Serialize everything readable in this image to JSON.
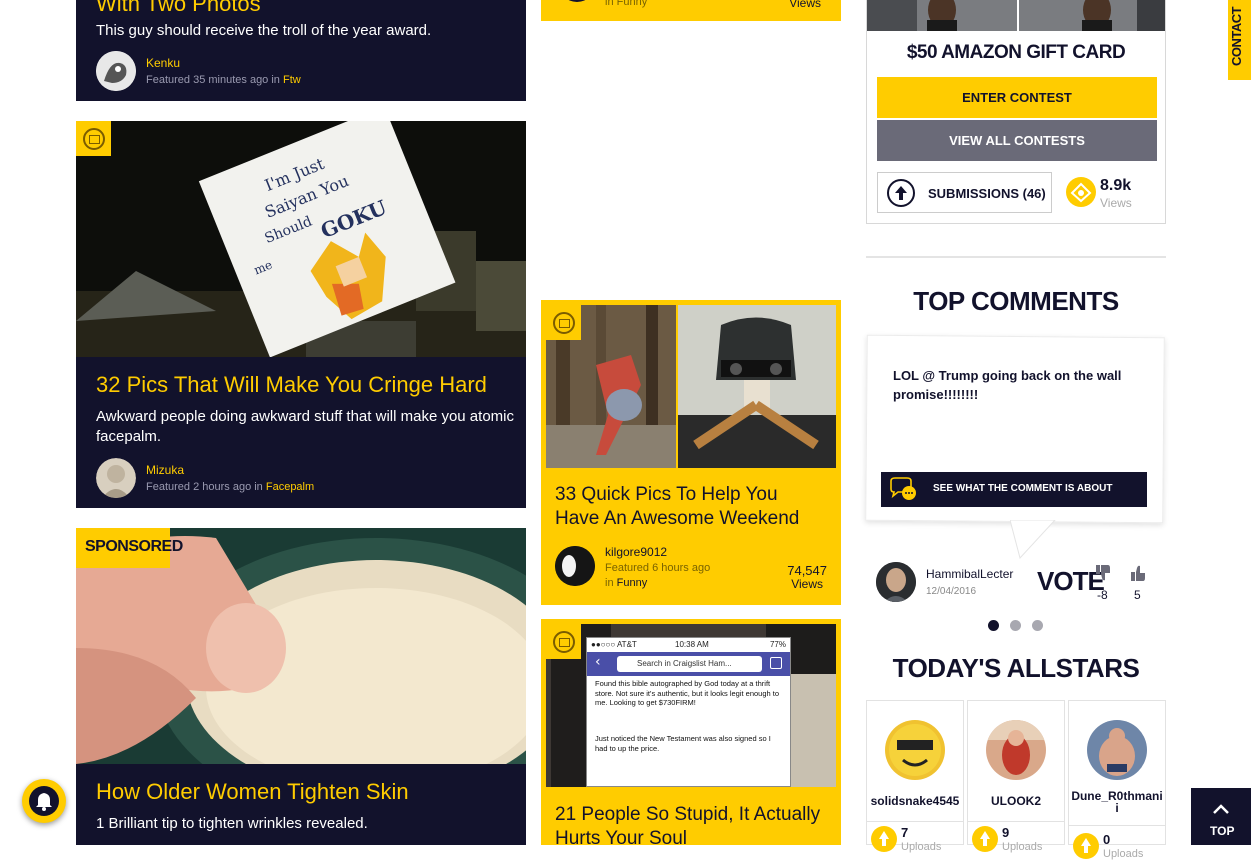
{
  "card1": {
    "title": "With Two Photos",
    "desc": "This guy should receive the troll of the year award.",
    "user": "Kenku",
    "meta_prefix": "Featured 35 minutes ago in ",
    "category": "Ftw"
  },
  "card2": {
    "image_sign_text": "I'm Just Saiyan You Should GOKU PROM with me",
    "title": "32 Pics That Will Make You Cringe Hard",
    "desc": "Awkward people doing awkward stuff that will make you atomic facepalm.",
    "user": "Mizuka",
    "meta_prefix": "Featured 2 hours ago in ",
    "category": "Facepalm"
  },
  "card3": {
    "sponsored_label": "SPONSORED",
    "title": "How Older Women Tighten Skin",
    "desc": "1 Brilliant tip to tighten wrinkles revealed."
  },
  "mid_top": {
    "meta": "in Funny",
    "views_label": "Views"
  },
  "mid_card1": {
    "title": "33 Quick Pics To Help You Have An Awesome Weekend",
    "user": "kilgore9012",
    "meta_prefix": "Featured 6 hours ago",
    "meta_in": "in ",
    "category": "Funny",
    "views": "74,547",
    "views_label": "Views"
  },
  "mid_card2": {
    "title": "21 People So Stupid, It Actually Hurts Your Soul",
    "phone_carrier": "●●○○○ AT&T",
    "phone_time": "10:38 AM",
    "phone_battery": "77%",
    "phone_search": "Search in Craigslist Ham...",
    "phone_text1": "Found this bible autographed by God today at a thrift store.  Not sure it's authentic, but it looks legit enough to me.  Looking to get $730FIRM!",
    "phone_text2": "Just noticed the New Testament was also signed so I had to up the price."
  },
  "contest": {
    "prize": "$50 AMAZON GIFT CARD",
    "enter_label": "ENTER CONTEST",
    "view_all_label": "VIEW ALL CONTESTS",
    "submissions_label": "SUBMISSIONS (46)",
    "views_value": "8.9k",
    "views_label": "Views"
  },
  "contact_tab": "CONTACT",
  "top_comments": {
    "heading": "TOP COMMENTS",
    "comment_text": "LOL @ Trump going back on the wall promise!!!!!!!!",
    "see_label": "SEE WHAT THE COMMENT IS ABOUT",
    "user": "HammibalLecter",
    "date": "12/04/2016",
    "vote_label": "VOTE",
    "down_count": "-8",
    "up_count": "5"
  },
  "allstars": {
    "heading": "TODAY'S ALLSTARS",
    "users": [
      {
        "name": "solidsnake4545",
        "count": "7",
        "label": "Uploads"
      },
      {
        "name": "ULOOK2",
        "count": "9",
        "label": "Uploads"
      },
      {
        "name": "Dune_R0thmanii",
        "count": "0",
        "label": "Uploads"
      }
    ]
  },
  "top_button": "TOP",
  "colors": {
    "accent": "#ffcc00",
    "navy": "#12122c"
  }
}
